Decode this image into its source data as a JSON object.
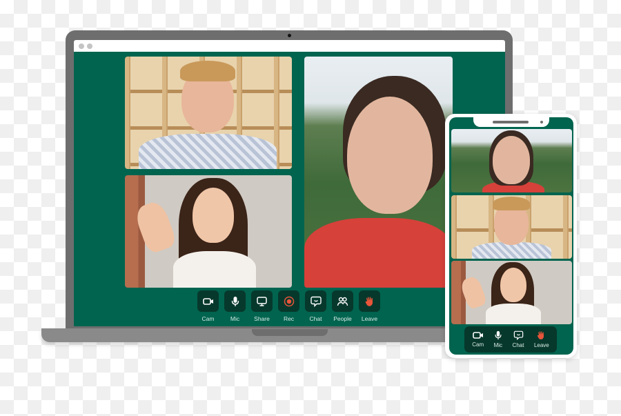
{
  "laptop": {
    "window_dots": 2,
    "controls": [
      {
        "id": "cam",
        "label": "Cam",
        "icon": "camera-icon"
      },
      {
        "id": "mic",
        "label": "Mic",
        "icon": "microphone-icon"
      },
      {
        "id": "share",
        "label": "Share",
        "icon": "screen-share-icon"
      },
      {
        "id": "rec",
        "label": "Rec",
        "icon": "record-icon"
      },
      {
        "id": "chat",
        "label": "Chat",
        "icon": "chat-icon"
      },
      {
        "id": "people",
        "label": "People",
        "icon": "people-icon"
      },
      {
        "id": "leave",
        "label": "Leave",
        "icon": "wave-hand-icon"
      }
    ],
    "participants": [
      {
        "tile": "man-bookshelf",
        "description": "Man in plaid shirt in front of bookshelf"
      },
      {
        "tile": "woman-waving",
        "description": "Woman waving in white top"
      },
      {
        "tile": "woman-forest",
        "description": "Woman in red top with forest background"
      }
    ]
  },
  "phone": {
    "controls": [
      {
        "id": "cam",
        "label": "Cam",
        "icon": "camera-icon"
      },
      {
        "id": "mic",
        "label": "Mic",
        "icon": "microphone-icon"
      },
      {
        "id": "chat",
        "label": "Chat",
        "icon": "chat-icon"
      },
      {
        "id": "leave",
        "label": "Leave",
        "icon": "wave-hand-icon"
      }
    ]
  },
  "colors": {
    "screen_bg": "#00644f",
    "button_bg": "#07382c",
    "record_accent": "#e8553a",
    "leave_accent": "#e8553a",
    "label_text": "#d9ece5"
  }
}
